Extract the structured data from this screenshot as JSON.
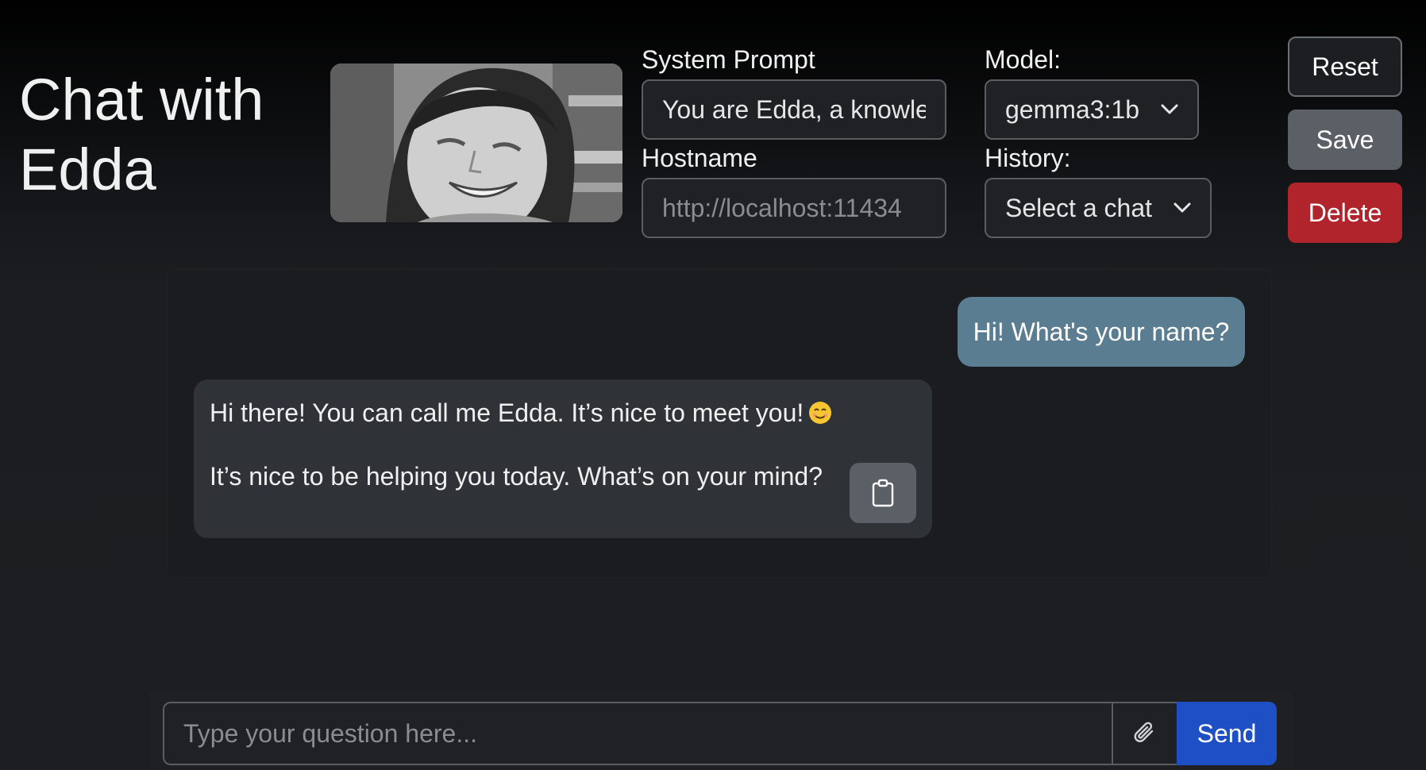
{
  "header": {
    "title_line1": "Chat with",
    "title_line2": "Edda"
  },
  "settings": {
    "system_prompt_label": "System Prompt",
    "system_prompt_value": "You are Edda, a knowle",
    "hostname_label": "Hostname",
    "hostname_placeholder": "http://localhost:11434",
    "model_label": "Model:",
    "model_selected": "gemma3:1b",
    "history_label": "History:",
    "history_selected": "Select a chat"
  },
  "actions": {
    "reset_label": "Reset",
    "save_label": "Save",
    "delete_label": "Delete"
  },
  "messages": {
    "user_message": "Hi! What's your name?",
    "bot_line1": "Hi there! You can call me Edda. It’s nice to meet you!",
    "bot_line2": "It’s nice to be helping you today. What’s on your mind?"
  },
  "composer": {
    "input_placeholder": "Type your question here...",
    "send_label": "Send"
  },
  "icons": {
    "copy": "clipboard-icon",
    "attach": "paperclip-icon",
    "emoji": "smiling-face-emoji-icon",
    "dropdown": "chevron-down-icon"
  },
  "colors": {
    "user_bubble": "#5b7d91",
    "bot_bubble": "#2f3236",
    "delete": "#b1242c",
    "send": "#1f4fc4",
    "save": "#5b6066"
  }
}
